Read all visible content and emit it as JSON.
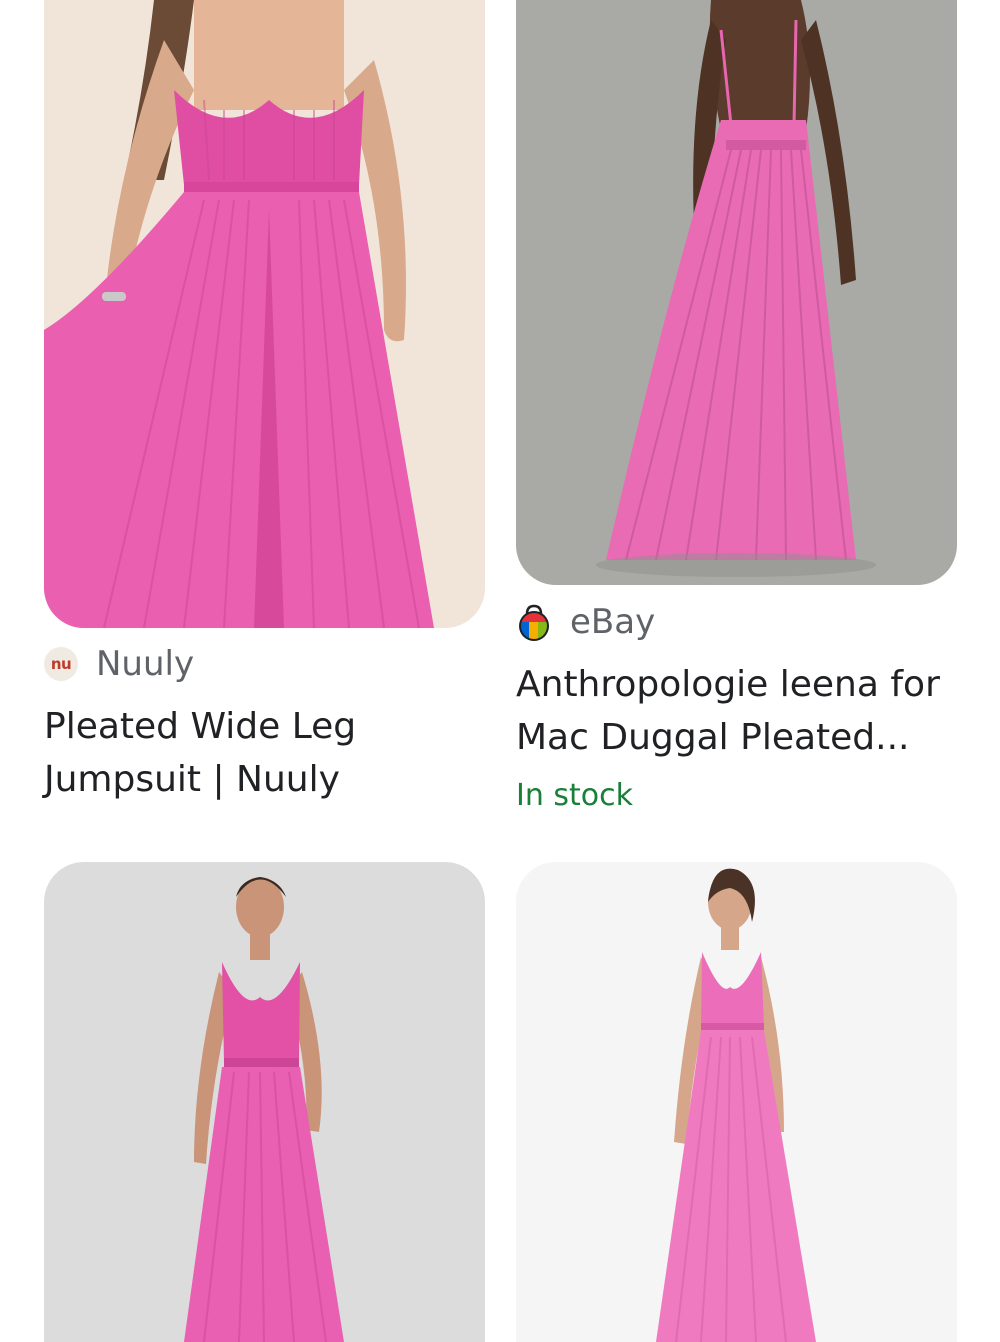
{
  "results": [
    {
      "source": "Nuuly",
      "source_logo_text": "nu",
      "title_line1": "Pleated Wide Leg",
      "title_line2": "Jumpsuit | Nuuly"
    },
    {
      "source": "eBay",
      "title_line1": "Anthropologie leena for",
      "title_line2": "Mac Duggal Pleated...",
      "stock_status": "In stock"
    },
    {
      "image": "pink-pleated-jumpsuit-front"
    },
    {
      "image": "pink-pleated-gown-front"
    }
  ],
  "colors": {
    "dress_pink": "#e75aa8",
    "in_stock_green": "#188038",
    "source_gray": "#5f6368"
  }
}
